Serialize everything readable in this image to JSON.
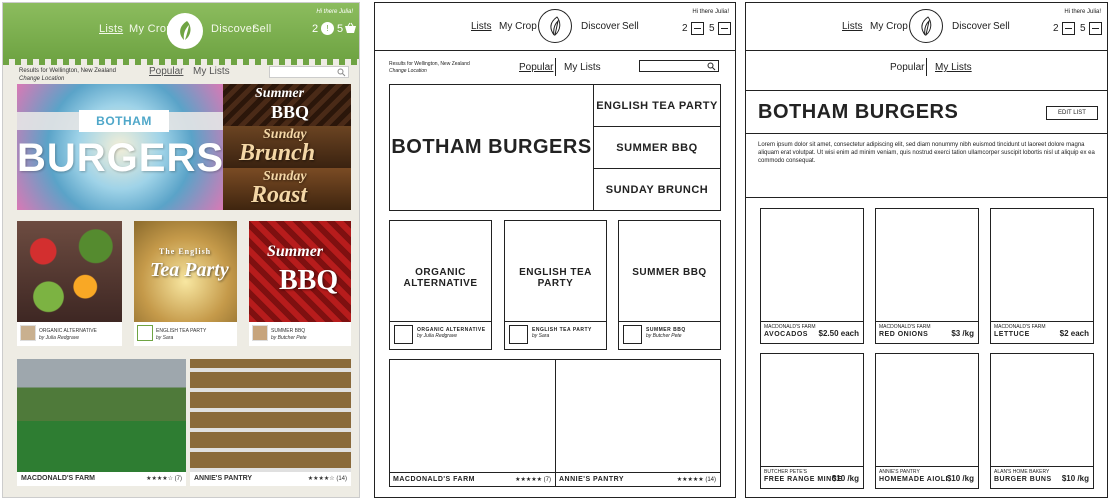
{
  "nav": {
    "lists": "Lists",
    "my_crop": "My Crop",
    "discover": "Discover",
    "sell": "Sell"
  },
  "greeting": "Hi there Julia!",
  "cart": {
    "count_left": "2",
    "count_right": "5",
    "badge": "!"
  },
  "tabs": {
    "popular": "Popular",
    "my_lists": "My Lists"
  },
  "results": {
    "line1": "Results for Wellington, New Zealand",
    "line2": "Change Location"
  },
  "panel1": {
    "hero": {
      "small": "Botham",
      "big": "Burgers"
    },
    "side_tiles": [
      {
        "line1": "Summer",
        "line2": "BBQ"
      },
      {
        "line1": "Sunday",
        "line2": "Brunch"
      },
      {
        "line1": "Sunday",
        "line2": "Roast"
      }
    ],
    "cards": [
      {
        "title": "Organic Alternative",
        "author": "by Julia Redgrave"
      },
      {
        "title": "English Tea Party",
        "author": "by Sara"
      },
      {
        "title": "Summer BBQ",
        "author": "by Butcher Pete"
      }
    ],
    "card_overlays": {
      "tea_small": "The English",
      "tea_big": "Tea Party",
      "bbq_small": "Summer",
      "bbq_big": "BBQ"
    },
    "bottom": [
      {
        "title": "Macdonald's Farm",
        "stars": "★★★★☆ (7)"
      },
      {
        "title": "Annie's Pantry",
        "stars": "★★★★☆ (14)"
      }
    ]
  },
  "panel2": {
    "hero": "Botham Burgers",
    "side": [
      "English Tea Party",
      "Summer BBQ",
      "Sunday Brunch"
    ],
    "cards": [
      {
        "title": "Organic Alternative",
        "sub": "Organic Alternative",
        "author": "by Julia Redgrave"
      },
      {
        "title": "English Tea Party",
        "sub": "English Tea Party",
        "author": "by Sara"
      },
      {
        "title": "Summer BBQ",
        "sub": "Summer BBQ",
        "author": "by Butcher Pete"
      }
    ],
    "bottom": [
      {
        "title": "Macdonald's Farm",
        "stars": "★★★★★ (7)"
      },
      {
        "title": "Annie's Pantry",
        "stars": "★★★★★ (14)"
      }
    ]
  },
  "panel3": {
    "title": "Botham Burgers",
    "edit": "Edit List",
    "desc": "Lorem ipsum dolor sit amet, consectetur adipiscing elit, sed diam nonummy nibh euismod tincidunt ut laoreet dolore magna aliquam erat volutpat. Ut wisi enim ad minim veniam, quis nostrud exerci tation ullamcorper suscipit lobortis nisl ut aliquip ex ea commodo consequat.",
    "products": [
      {
        "seller": "Macdonald's Farm",
        "name": "Avocados",
        "price": "$2.50 each"
      },
      {
        "seller": "Macdonald's Farm",
        "name": "Red Onions",
        "price": "$3 /kg"
      },
      {
        "seller": "Macdonald's Farm",
        "name": "Lettuce",
        "price": "$2 each"
      },
      {
        "seller": "Butcher Pete's",
        "name": "Free Range Mince",
        "price": "$10 /kg"
      },
      {
        "seller": "Annie's Pantry",
        "name": "Homemade Aioli",
        "price": "$10 /kg"
      },
      {
        "seller": "Alan's Home Bakery",
        "name": "Burger Buns",
        "price": "$10 /kg"
      }
    ]
  },
  "colors": {
    "brand_green": "#7cb14f",
    "wire_stroke": "#222222"
  },
  "icons": [
    "leaf-logo-icon",
    "search-icon",
    "cart-icon"
  ]
}
